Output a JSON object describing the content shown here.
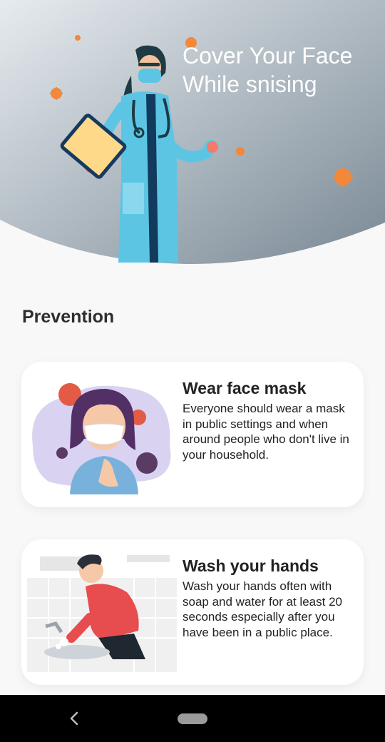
{
  "header": {
    "title": "Cover Your Face While snising",
    "illustration": "doctor-with-clipboard-and-viruses"
  },
  "section": {
    "title": "Prevention"
  },
  "cards": [
    {
      "title": "Wear face mask",
      "description": "Everyone should wear a mask in public settings and when around people who don't live in your household.",
      "illustration": "girl-wearing-mask"
    },
    {
      "title": "Wash your hands",
      "description": "Wash your hands often with soap and water for at least 20 seconds especially after you have been in a public place.",
      "illustration": "man-washing-hands"
    }
  ],
  "navbar": {
    "back_icon": "back-chevron-icon",
    "home_icon": "home-pill-icon"
  },
  "colors": {
    "header_gradient_start": "#e3e8ed",
    "header_gradient_end": "#7b8a96",
    "background": "#f8f8f9",
    "card": "#ffffff",
    "navbar": "#000000"
  }
}
